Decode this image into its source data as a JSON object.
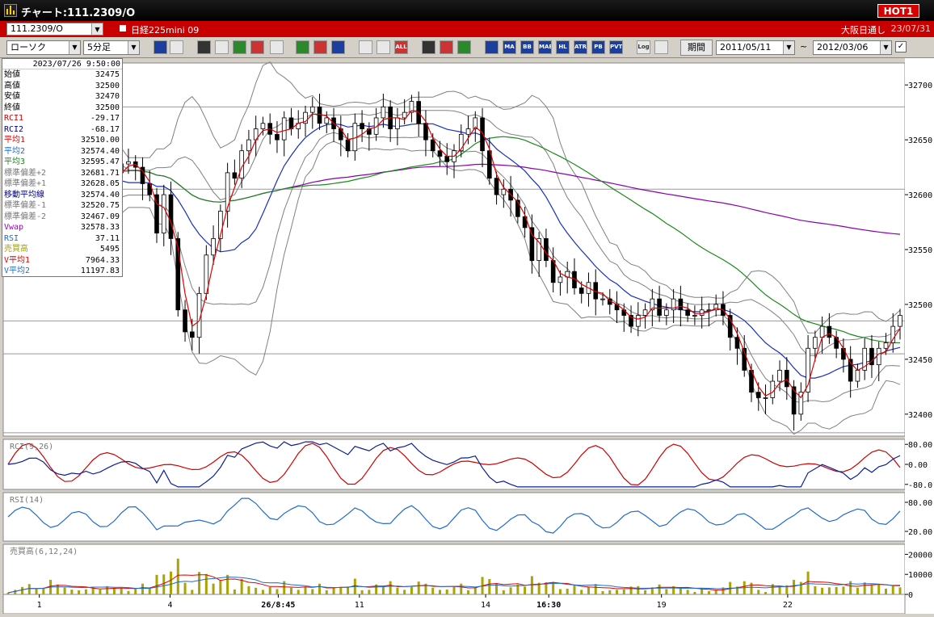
{
  "window": {
    "title": "チャート:111.2309/O",
    "hot_label": "HOT1"
  },
  "infobar": {
    "symbol_code": "111.2309/O",
    "symbol_name": "日経225mini 09",
    "session": "大阪日通し",
    "date": "23/07/31"
  },
  "toolbar": {
    "chart_type": "ローソク",
    "timeframe": "5分足",
    "period_button": "期間",
    "from_date": "2011/05/11",
    "to_date": "2012/03/06",
    "tilde": "~",
    "icons": [
      {
        "name": "zoom-icon",
        "label": ""
      },
      {
        "name": "cursor-icon",
        "label": ""
      },
      {
        "name": "download-icon",
        "label": ""
      },
      {
        "name": "search-icon",
        "label": ""
      },
      {
        "name": "chart-window-icon",
        "label": ""
      },
      {
        "name": "split-icon",
        "label": ""
      },
      {
        "name": "scroll-end-icon",
        "label": ""
      },
      {
        "name": "line-draw-icon",
        "label": ""
      },
      {
        "name": "erase-icon",
        "label": ""
      },
      {
        "name": "undo-icon",
        "label": ""
      },
      {
        "name": "add-indicator-icon",
        "label": ""
      },
      {
        "name": "remove-indicator-icon",
        "label": ""
      },
      {
        "name": "all-icon",
        "label": "ALL"
      },
      {
        "name": "gear-icon",
        "label": ""
      },
      {
        "name": "tool-icon",
        "label": ""
      },
      {
        "name": "color-icon",
        "label": ""
      },
      {
        "name": "grid-icon",
        "label": ""
      },
      {
        "name": "ma-icon",
        "label": "MA"
      },
      {
        "name": "bb-icon",
        "label": "BB"
      },
      {
        "name": "mae-icon",
        "label": "MAE"
      },
      {
        "name": "hl-icon",
        "label": "HL"
      },
      {
        "name": "atr-icon",
        "label": "ATR"
      },
      {
        "name": "pb-icon",
        "label": "PB"
      },
      {
        "name": "pvt-icon",
        "label": "PVT"
      },
      {
        "name": "log-icon",
        "label": "Log"
      },
      {
        "name": "export-icon",
        "label": ""
      }
    ]
  },
  "ohlc_panel": {
    "datetime": "2023/07/26 9:50:00",
    "rows": [
      {
        "label": "始値",
        "value": "32475",
        "color": "#000000"
      },
      {
        "label": "高値",
        "value": "32500",
        "color": "#000000"
      },
      {
        "label": "安値",
        "value": "32470",
        "color": "#000000"
      },
      {
        "label": "終値",
        "value": "32500",
        "color": "#000000"
      },
      {
        "label": "RCI1",
        "value": "-29.17",
        "color": "#d00000"
      },
      {
        "label": "RCI2",
        "value": "-68.17",
        "color": "#00008b"
      },
      {
        "label": "平均1",
        "value": "32510.00",
        "color": "#e00000"
      },
      {
        "label": "平均2",
        "value": "32574.40",
        "color": "#1e6bd0"
      },
      {
        "label": "平均3",
        "value": "32595.47",
        "color": "#1a8a1a"
      },
      {
        "label": "標準偏差+2",
        "value": "32681.71",
        "color": "#777777"
      },
      {
        "label": "標準偏差+1",
        "value": "32628.05",
        "color": "#777777"
      },
      {
        "label": "移動平均線",
        "value": "32574.40",
        "color": "#00008b"
      },
      {
        "label": "標準偏差-1",
        "value": "32520.75",
        "color": "#777777"
      },
      {
        "label": "標準偏差-2",
        "value": "32467.09",
        "color": "#777777"
      },
      {
        "label": "Vwap",
        "value": "32578.33",
        "color": "#a000c0"
      },
      {
        "label": "RSI",
        "value": "37.11",
        "color": "#1e6bd0"
      },
      {
        "label": "売買高",
        "value": "5495",
        "color": "#a0a000"
      },
      {
        "label": "V平均1",
        "value": "7964.33",
        "color": "#e00000"
      },
      {
        "label": "V平均2",
        "value": "11197.83",
        "color": "#1e6bd0"
      }
    ]
  },
  "colors": {
    "candle": "#000000",
    "ma1": "#e00000",
    "ma2": "#1a2fc0",
    "ma3": "#1a8a1a",
    "bollinger": "#808080",
    "vwap": "#8a00b0",
    "rci1": "#d00000",
    "rci2": "#0b1f9a",
    "rsi": "#1e6bd0",
    "volume": "#a8a400",
    "vma1": "#e00000",
    "vma2": "#1e6bd0"
  },
  "chart_data": [
    {
      "type": "candlestick",
      "title": "",
      "y_ticks": [
        32700,
        32650,
        32600,
        32550,
        32500,
        32450,
        32400
      ],
      "ylim": [
        32380,
        32720
      ],
      "x_ticks": [
        "1",
        "4",
        "26/8:45",
        "11",
        "14",
        "16:30",
        "19",
        "22"
      ],
      "horizontal_lines": [
        32680,
        32605,
        32485,
        32455,
        32383
      ],
      "close_series": [
        32625,
        32630,
        32640,
        32655,
        32660,
        32650,
        32625,
        32610,
        32602,
        32605,
        32600,
        32606,
        32596,
        32600,
        32610,
        32620,
        32628,
        32630,
        32625,
        32610,
        32600,
        32565,
        32600,
        32560,
        32495,
        32475,
        32470,
        32510,
        32545,
        32560,
        32585,
        32620,
        32615,
        32640,
        32650,
        32660,
        32665,
        32655,
        32650,
        32670,
        32660,
        32665,
        32675,
        32680,
        32665,
        32670,
        32660,
        32650,
        32640,
        32665,
        32660,
        32655,
        32670,
        32680,
        32660,
        32670,
        32675,
        32685,
        32665,
        32650,
        32640,
        32635,
        32630,
        32640,
        32655,
        32660,
        32670,
        32640,
        32615,
        32600,
        32605,
        32595,
        32580,
        32570,
        32540,
        32560,
        32540,
        32520,
        32525,
        32530,
        32515,
        32510,
        32520,
        32505,
        32505,
        32500,
        32495,
        32490,
        32480,
        32490,
        32495,
        32505,
        32490,
        32495,
        32505,
        32495,
        32490,
        32490,
        32495,
        32495,
        32500,
        32490,
        32470,
        32460,
        32440,
        32420,
        32415,
        32415,
        32430,
        32440,
        32425,
        32400,
        32420,
        32460,
        32470,
        32480,
        32470,
        32460,
        32450,
        32430,
        32440,
        32460,
        32445,
        32460,
        32465,
        32480,
        32490
      ],
      "volume": {
        "ylim": [
          0,
          25000
        ],
        "y_ticks": [
          20000,
          10000,
          0
        ]
      }
    },
    {
      "type": "line",
      "title": "RCI(9,26)",
      "y_ticks": [
        "80.00",
        "0.00",
        "-80.0"
      ],
      "ylim": [
        -100,
        100
      ],
      "series": [
        {
          "name": "RCI1"
        },
        {
          "name": "RCI2"
        }
      ]
    },
    {
      "type": "line",
      "title": "RSI(14)",
      "y_ticks": [
        "80.00",
        "20.00"
      ],
      "ylim": [
        0,
        100
      ],
      "series": [
        {
          "name": "RSI"
        }
      ]
    },
    {
      "type": "bar",
      "title": "売買高(6,12,24)",
      "y_ticks": [
        "20000",
        "10000",
        "0"
      ],
      "ylim": [
        0,
        25000
      ]
    }
  ]
}
